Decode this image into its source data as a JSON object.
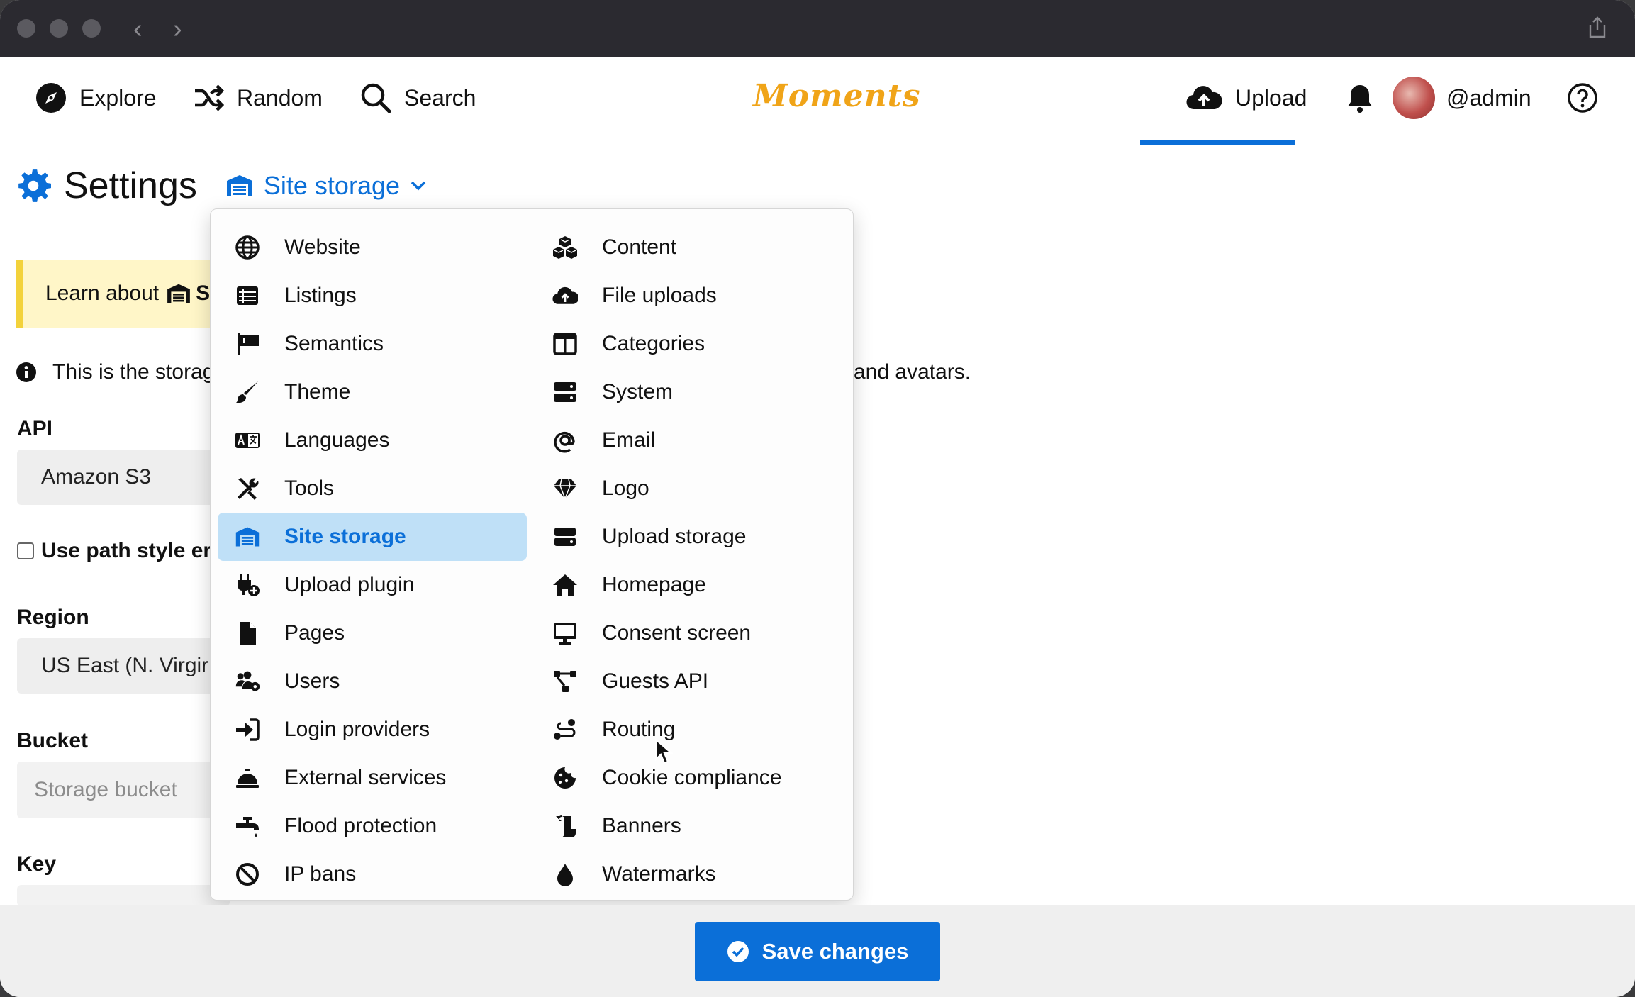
{
  "nav": {
    "explore": "Explore",
    "random": "Random",
    "search": "Search",
    "brand": "Moments",
    "upload": "Upload",
    "username": "@admin"
  },
  "heading": {
    "title": "Settings",
    "current_section": "Site storage"
  },
  "page": {
    "learn_text": "Learn about",
    "learn_cut": "S",
    "info_text": "This is the storag",
    "info_tail": "and avatars.",
    "api_label": "API",
    "api_value": "Amazon S3",
    "path_style_label": "Use path style er",
    "region_label": "Region",
    "region_value": "US East (N. Virgir",
    "bucket_label": "Bucket",
    "bucket_placeholder": "Storage bucket",
    "key_label": "Key"
  },
  "menu": {
    "left": [
      {
        "label": "Website",
        "icon": "globe-icon"
      },
      {
        "label": "Listings",
        "icon": "list-icon"
      },
      {
        "label": "Semantics",
        "icon": "flag-icon"
      },
      {
        "label": "Theme",
        "icon": "paintbrush-icon"
      },
      {
        "label": "Languages",
        "icon": "language-icon"
      },
      {
        "label": "Tools",
        "icon": "tools-icon"
      },
      {
        "label": "Site storage",
        "icon": "warehouse-icon"
      },
      {
        "label": "Upload plugin",
        "icon": "plug-icon"
      },
      {
        "label": "Pages",
        "icon": "file-icon"
      },
      {
        "label": "Users",
        "icon": "users-icon"
      },
      {
        "label": "Login providers",
        "icon": "sign-in-icon"
      },
      {
        "label": "External services",
        "icon": "bell-concierge-icon"
      },
      {
        "label": "Flood protection",
        "icon": "faucet-icon"
      },
      {
        "label": "IP bans",
        "icon": "ban-icon"
      }
    ],
    "right": [
      {
        "label": "Content",
        "icon": "cubes-icon"
      },
      {
        "label": "File uploads",
        "icon": "cloud-upload-icon"
      },
      {
        "label": "Categories",
        "icon": "columns-icon"
      },
      {
        "label": "System",
        "icon": "server-icon"
      },
      {
        "label": "Email",
        "icon": "at-icon"
      },
      {
        "label": "Logo",
        "icon": "gem-icon"
      },
      {
        "label": "Upload storage",
        "icon": "hdd-icon"
      },
      {
        "label": "Homepage",
        "icon": "home-icon"
      },
      {
        "label": "Consent screen",
        "icon": "desktop-icon"
      },
      {
        "label": "Guests API",
        "icon": "network-icon"
      },
      {
        "label": "Routing",
        "icon": "route-icon"
      },
      {
        "label": "Cookie compliance",
        "icon": "cookie-icon"
      },
      {
        "label": "Banners",
        "icon": "scroll-icon"
      },
      {
        "label": "Watermarks",
        "icon": "tint-icon"
      }
    ],
    "active": "Site storage"
  },
  "footer": {
    "save_label": "Save changes"
  },
  "colors": {
    "accent": "#0b6fd8",
    "brand": "#f0a418",
    "active_bg": "#bfe0f7",
    "notice_bg": "#fff6c8"
  }
}
